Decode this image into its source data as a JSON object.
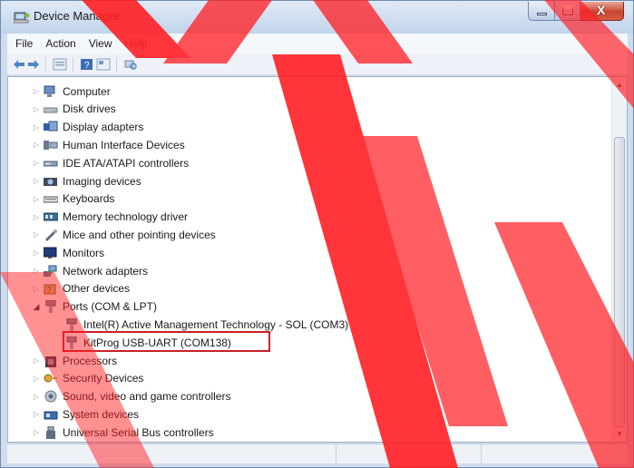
{
  "window": {
    "title": "Device Manager",
    "controls": {
      "minimize": "minimize",
      "maximize": "maximize",
      "close": "X"
    }
  },
  "menu": [
    "File",
    "Action",
    "View",
    "Help"
  ],
  "toolbar": {
    "buttons": [
      "back-icon",
      "forward-icon",
      "properties-icon",
      "help-icon",
      "update-driver-icon",
      "scan-hardware-icon"
    ]
  },
  "tree": {
    "items": [
      {
        "label": "Computer",
        "icon": "computer-icon",
        "expanded": false,
        "level": 0
      },
      {
        "label": "Disk drives",
        "icon": "disk-icon",
        "expanded": false,
        "level": 0
      },
      {
        "label": "Display adapters",
        "icon": "display-icon",
        "expanded": false,
        "level": 0
      },
      {
        "label": "Human Interface Devices",
        "icon": "hid-icon",
        "expanded": false,
        "level": 0
      },
      {
        "label": "IDE ATA/ATAPI controllers",
        "icon": "ide-icon",
        "expanded": false,
        "level": 0
      },
      {
        "label": "Imaging devices",
        "icon": "camera-icon",
        "expanded": false,
        "level": 0
      },
      {
        "label": "Keyboards",
        "icon": "keyboard-icon",
        "expanded": false,
        "level": 0
      },
      {
        "label": "Memory technology driver",
        "icon": "memory-icon",
        "expanded": false,
        "level": 0
      },
      {
        "label": "Mice and other pointing devices",
        "icon": "mouse-icon",
        "expanded": false,
        "level": 0
      },
      {
        "label": "Monitors",
        "icon": "monitor-icon",
        "expanded": false,
        "level": 0
      },
      {
        "label": "Network adapters",
        "icon": "network-icon",
        "expanded": false,
        "level": 0
      },
      {
        "label": "Other devices",
        "icon": "unknown-device-icon",
        "expanded": false,
        "level": 0
      },
      {
        "label": "Ports (COM & LPT)",
        "icon": "port-icon",
        "expanded": true,
        "level": 0
      },
      {
        "label": "Intel(R) Active Management Technology - SOL (COM3)",
        "icon": "port-icon",
        "expanded": null,
        "level": 1
      },
      {
        "label": "KitProg USB-UART (COM138)",
        "icon": "port-icon",
        "expanded": null,
        "level": 1,
        "highlighted": true
      },
      {
        "label": "Processors",
        "icon": "processor-icon",
        "expanded": false,
        "level": 0
      },
      {
        "label": "Security Devices",
        "icon": "security-key-icon",
        "expanded": false,
        "level": 0
      },
      {
        "label": "Sound, video and game controllers",
        "icon": "speaker-icon",
        "expanded": false,
        "level": 0
      },
      {
        "label": "System devices",
        "icon": "system-icon",
        "expanded": false,
        "level": 0
      },
      {
        "label": "Universal Serial Bus controllers",
        "icon": "usb-icon",
        "expanded": false,
        "level": 0
      }
    ]
  },
  "colors": {
    "highlight_border": "#c9202a",
    "watermark": "#ff1f24",
    "titlebar": "#c2d4ea"
  }
}
